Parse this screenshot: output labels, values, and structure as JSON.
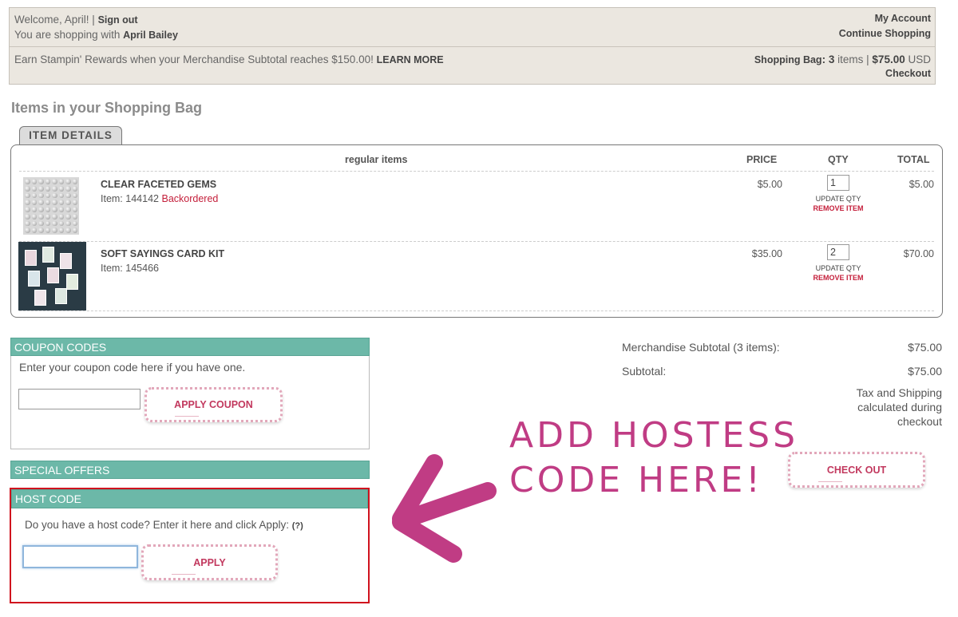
{
  "header": {
    "welcome": "Welcome, April!",
    "pipe": "|",
    "sign_out": "Sign out",
    "shopping_with_prefix": "You are shopping with",
    "demonstrator": "April Bailey",
    "my_account": "My Account",
    "continue_shopping": "Continue Shopping",
    "rewards_text": "Earn Stampin' Rewards when your Merchandise Subtotal reaches $150.00!",
    "learn_more": "LEARN MORE",
    "bag_label": "Shopping Bag",
    "bag_colon": ":",
    "bag_count": "3",
    "bag_items_word": "items",
    "bag_sep": "|",
    "bag_total": "$75.00",
    "bag_currency": "USD",
    "checkout": "Checkout"
  },
  "page_title": "Items in your Shopping Bag",
  "item_details": {
    "tab": "ITEM DETAILS",
    "columns": {
      "items": "regular items",
      "price": "PRICE",
      "qty": "QTY",
      "total": "TOTAL"
    },
    "items": [
      {
        "name": "CLEAR FACETED GEMS",
        "item_label": "Item:",
        "item_no": "144142",
        "status": "Backordered",
        "price": "$5.00",
        "qty": "1",
        "update": "UPDATE QTY",
        "remove": "REMOVE ITEM",
        "total": "$5.00"
      },
      {
        "name": "SOFT SAYINGS CARD KIT",
        "item_label": "Item:",
        "item_no": "145466",
        "status": "",
        "price": "$35.00",
        "qty": "2",
        "update": "UPDATE QTY",
        "remove": "REMOVE ITEM",
        "total": "$70.00"
      }
    ]
  },
  "coupon": {
    "title": "COUPON CODES",
    "text": "Enter your coupon code here if you have one.",
    "input_value": "",
    "button": "APPLY COUPON"
  },
  "special_offers": {
    "title": "SPECIAL OFFERS"
  },
  "host_code": {
    "title": "HOST CODE",
    "text": "Do you have a host code? Enter it here and click Apply:",
    "help": "(?)",
    "input_value": "",
    "button": "APPLY"
  },
  "summary": {
    "merch_label": "Merchandise Subtotal (3 items):",
    "merch_value": "$75.00",
    "subtotal_label": "Subtotal:",
    "subtotal_value": "$75.00",
    "tax_line1": "Tax and Shipping",
    "tax_line2": "calculated during",
    "tax_line3": "checkout",
    "checkout_button": "CHECK OUT"
  },
  "annotation": {
    "line1": "ADD HOSTESS",
    "line2": "CODE HERE!"
  },
  "colors": {
    "accent_teal": "#6cb8a8",
    "button_pink": "#c2385e",
    "annotation_magenta": "#c03c84",
    "highlight_red": "#d0121e",
    "header_bg": "#ebe7e0"
  },
  "icons": {
    "arrow": "arrow-icon"
  }
}
